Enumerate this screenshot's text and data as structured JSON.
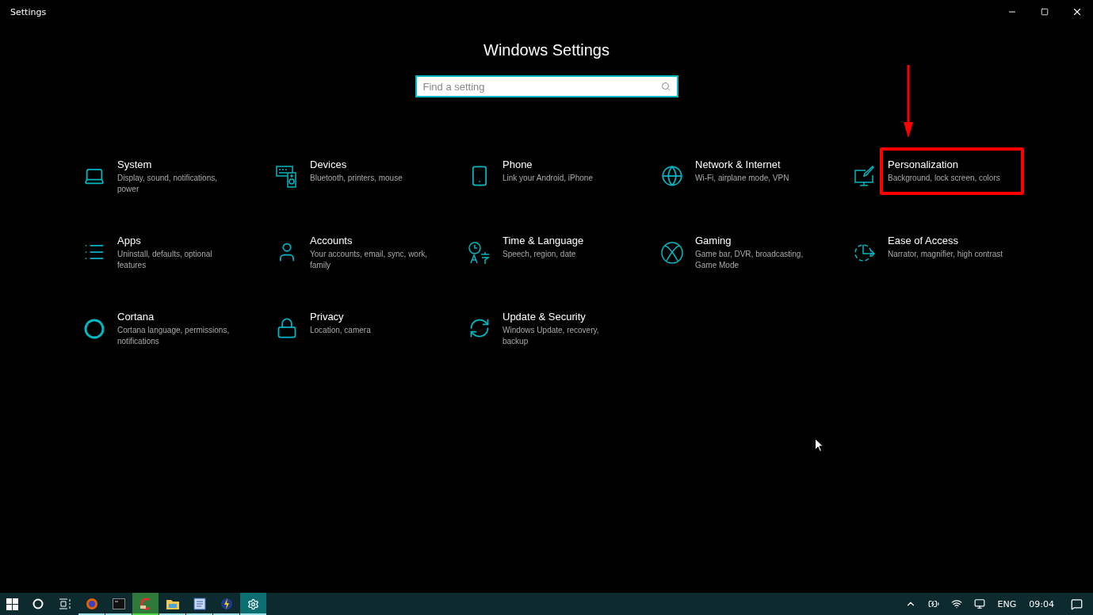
{
  "window": {
    "title": "Settings"
  },
  "heading": "Windows Settings",
  "search": {
    "placeholder": "Find a setting"
  },
  "categories": [
    {
      "title": "System",
      "description": "Display, sound, notifications, power",
      "highlighted": false
    },
    {
      "title": "Devices",
      "description": "Bluetooth, printers, mouse",
      "highlighted": false
    },
    {
      "title": "Phone",
      "description": "Link your Android, iPhone",
      "highlighted": false
    },
    {
      "title": "Network & Internet",
      "description": "Wi-Fi, airplane mode, VPN",
      "highlighted": false
    },
    {
      "title": "Personalization",
      "description": "Background, lock screen, colors",
      "highlighted": true
    },
    {
      "title": "Apps",
      "description": "Uninstall, defaults, optional features",
      "highlighted": false
    },
    {
      "title": "Accounts",
      "description": "Your accounts, email, sync, work, family",
      "highlighted": false
    },
    {
      "title": "Time & Language",
      "description": "Speech, region, date",
      "highlighted": false
    },
    {
      "title": "Gaming",
      "description": "Game bar, DVR, broadcasting, Game Mode",
      "highlighted": false
    },
    {
      "title": "Ease of Access",
      "description": "Narrator, magnifier, high contrast",
      "highlighted": false
    },
    {
      "title": "Cortana",
      "description": "Cortana language, permissions, notifications",
      "highlighted": false
    },
    {
      "title": "Privacy",
      "description": "Location, camera",
      "highlighted": false
    },
    {
      "title": "Update & Security",
      "description": "Windows Update, recovery, backup",
      "highlighted": false
    }
  ],
  "taskbar": {
    "apps": [
      {
        "running": true,
        "attention": false,
        "selected": false
      },
      {
        "running": true,
        "attention": false,
        "selected": false
      },
      {
        "running": false,
        "attention": true,
        "selected": false
      },
      {
        "running": true,
        "attention": false,
        "selected": false
      },
      {
        "running": true,
        "attention": false,
        "selected": false
      },
      {
        "running": true,
        "attention": false,
        "selected": false
      },
      {
        "running": true,
        "attention": false,
        "selected": true
      }
    ],
    "language": "ENG",
    "time": "09:04"
  }
}
